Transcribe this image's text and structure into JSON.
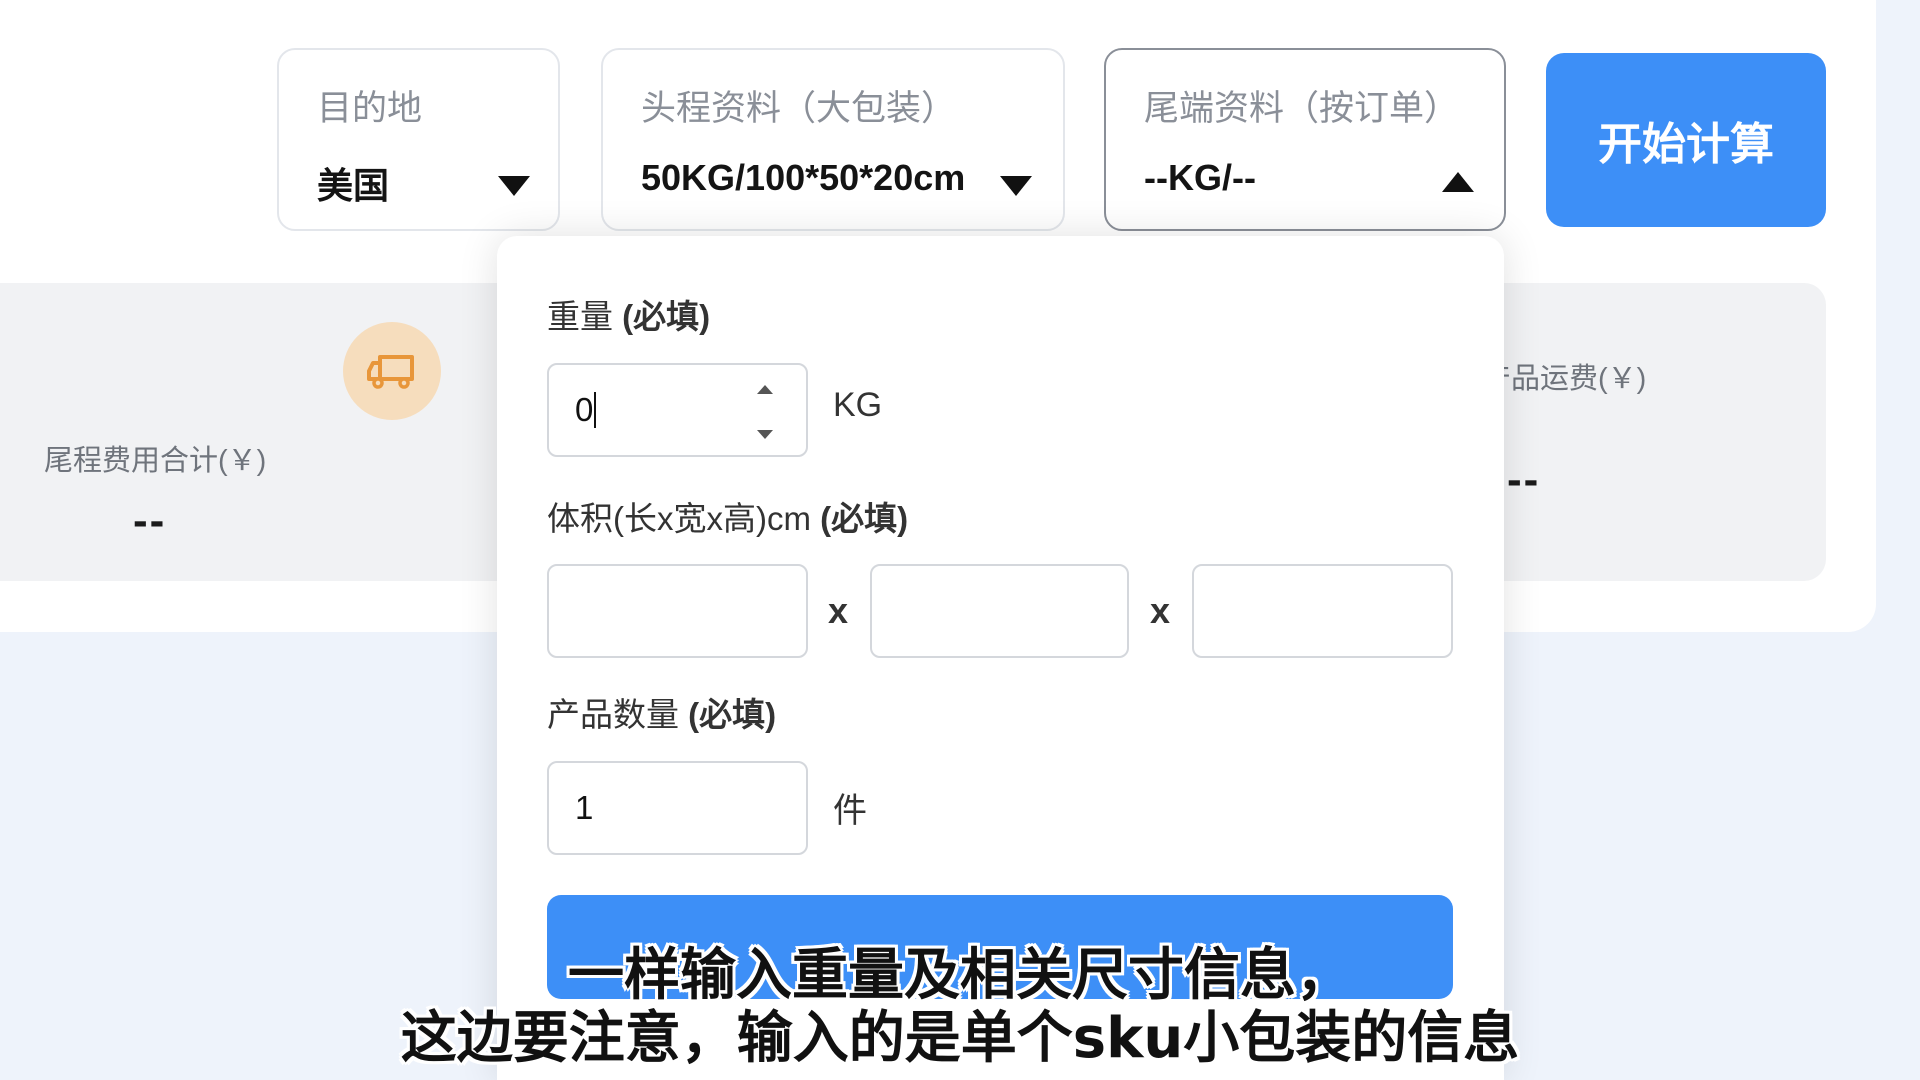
{
  "selectors": {
    "destination": {
      "label": "目的地",
      "value": "美国"
    },
    "first_leg": {
      "label": "头程资料（大包装）",
      "value": "50KG/100*50*20cm"
    },
    "last_leg": {
      "label": "尾端资料（按订单）",
      "value": "--KG/--"
    }
  },
  "start_button": {
    "label": "开始计算"
  },
  "summary": {
    "tail_total_label": "尾程费用合计(￥)",
    "tail_total_value": "--",
    "product_freight_label": "产品运费(￥)",
    "product_freight_value": "--",
    "truck_icon": "truck-icon"
  },
  "panel": {
    "weight_label": "重量",
    "weight_required": "(必填)",
    "weight_value": "0",
    "weight_unit": "KG",
    "volume_label": "体积(长x宽x高)cm",
    "volume_required": "(必填)",
    "volume_length": "",
    "volume_width": "",
    "volume_height": "",
    "times_symbol": "x",
    "quantity_label": "产品数量",
    "quantity_required": "(必填)",
    "quantity_value": "1",
    "quantity_unit": "件"
  },
  "subtitles": {
    "line1": "一样输入重量及相关尺寸信息，",
    "line2": "这边要注意，输入的是单个sku小包装的信息"
  },
  "colors": {
    "accent": "#3d8ff7",
    "badge_bg": "#f6ddbd",
    "badge_icon": "#e8963a"
  }
}
